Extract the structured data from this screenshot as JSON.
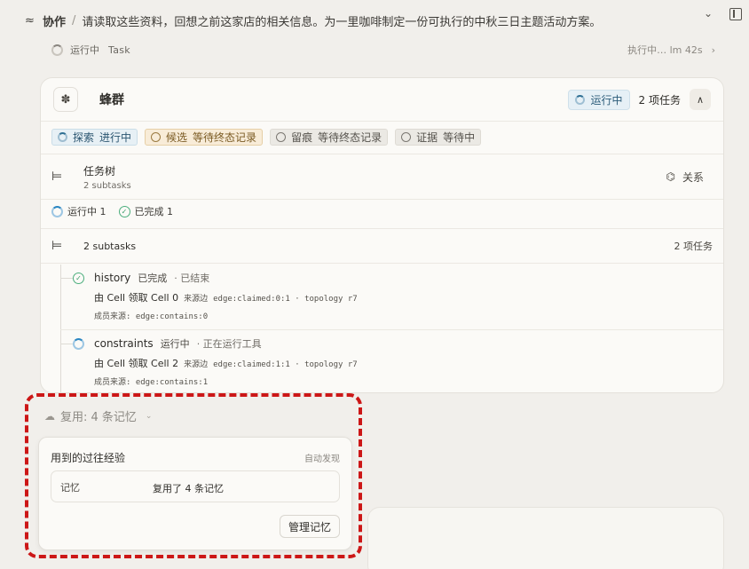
{
  "header": {
    "collab_label": "协作",
    "separator": "/",
    "prompt": "请读取这些资料，回想之前这家店的相关信息。为一里咖啡制定一份可执行的中秋三日主题活动方案。"
  },
  "task": {
    "status": "运行中",
    "label": "Task",
    "progress": "执行中… lm 42s"
  },
  "swarm": {
    "title": "蜂群",
    "status": "运行中",
    "count": "2 项任务",
    "phases": [
      {
        "name": "探索",
        "state": "进行中"
      },
      {
        "name": "候选",
        "state": "等待终态记录"
      },
      {
        "name": "留痕",
        "state": "等待终态记录"
      },
      {
        "name": "证据",
        "state": "等待中"
      }
    ]
  },
  "tree": {
    "title": "任务树",
    "subtitle": "2 subtasks",
    "relation_label": "关系",
    "stats": {
      "running": "运行中 1",
      "done": "已完成 1"
    },
    "subtasks_label": "2 subtasks",
    "subtasks_count": "2 项任务",
    "items": [
      {
        "name": "history",
        "status": "已完成",
        "extra": "· 已结束",
        "cell": "由 Cell 领取 Cell 0",
        "source_label": "来源边",
        "edge": "edge:claimed:0:1 · topology r7",
        "member": "成员来源: edge:contains:0"
      },
      {
        "name": "constraints",
        "status": "运行中",
        "extra": "· 正在运行工具",
        "cell": "由 Cell 领取 Cell 2",
        "source_label": "来源边",
        "edge": "edge:claimed:1:1 · topology r7",
        "member": "成员来源: edge:contains:1"
      }
    ]
  },
  "reuse": {
    "label": "复用: 4 条记忆"
  },
  "memory_card": {
    "title": "用到的过往经验",
    "auto": "自动发现",
    "key": "记忆",
    "value": "复用了 4 条记忆",
    "manage_button": "管理记忆"
  },
  "colors": {
    "accent_run": "#2f6f93",
    "done_green": "#3a9a69",
    "highlight": "#cc1717"
  }
}
